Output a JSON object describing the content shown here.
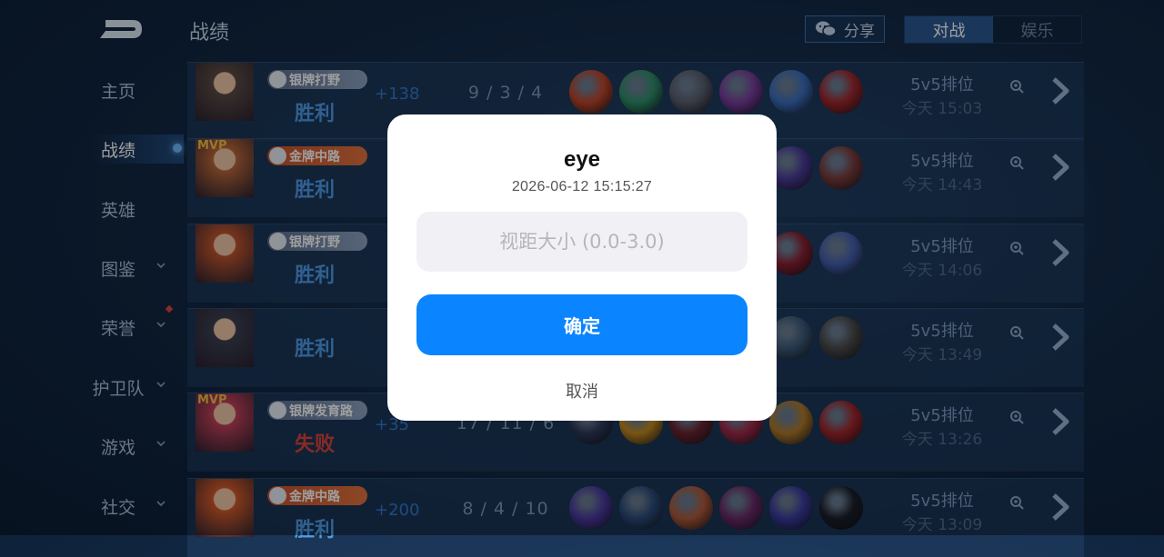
{
  "header": {
    "title": "战绩",
    "share_label": "分享",
    "segments": [
      {
        "label": "对战",
        "active": true
      },
      {
        "label": "娱乐",
        "active": false
      }
    ]
  },
  "sidebar": {
    "items": [
      {
        "label": "主页",
        "has_chevron": false
      },
      {
        "label": "战绩",
        "has_chevron": false,
        "active": true
      },
      {
        "label": "英雄",
        "has_chevron": false
      },
      {
        "label": "图鉴",
        "has_chevron": true
      },
      {
        "label": "荣誉",
        "has_chevron": true,
        "has_red_dot": true
      },
      {
        "label": "护卫队",
        "has_chevron": true
      },
      {
        "label": "游戏",
        "has_chevron": true
      },
      {
        "label": "社交",
        "has_chevron": true
      }
    ]
  },
  "matches": [
    {
      "badge": "银牌打野",
      "badge_tier": "silver",
      "mvp": false,
      "result": "胜利",
      "outcome": "win",
      "score": "+138",
      "kda": "9 / 3 / 4",
      "mode": "5v5排位",
      "time": "今天 15:03",
      "avatar_color": "#5b4a44",
      "item_colors": [
        "#c0452a",
        "#2f8f6a",
        "#5a5f6e",
        "#7a3d9e",
        "#3a6fc0",
        "#a3262c"
      ]
    },
    {
      "badge": "金牌中路",
      "badge_tier": "gold",
      "mvp": true,
      "result": "胜利",
      "outcome": "win",
      "score": "",
      "kda": "",
      "mode": "5v5排位",
      "time": "今天 14:43",
      "avatar_color": "#b8663a",
      "item_colors": [
        "#4b3a9a",
        "#7a3b3b"
      ]
    },
    {
      "badge": "银牌打野",
      "badge_tier": "silver",
      "mvp": false,
      "result": "胜利",
      "outcome": "win",
      "score": "",
      "kda": "",
      "mode": "5v5排位",
      "time": "今天 14:06",
      "avatar_color": "#c0552e",
      "item_colors": [
        "#8a2030",
        "#4460b0"
      ]
    },
    {
      "badge": "",
      "badge_tier": "",
      "mvp": false,
      "result": "胜利",
      "outcome": "win",
      "score": "",
      "kda": "",
      "mode": "5v5排位",
      "time": "今天 13:49",
      "avatar_color": "#3b3f52",
      "item_colors": [
        "#3b5a7a",
        "#4a4a4a"
      ]
    },
    {
      "badge": "银牌发育路",
      "badge_tier": "silver",
      "mvp": true,
      "result": "失败",
      "outcome": "lose",
      "score": "+35",
      "kda": "17 / 11 / 6",
      "mode": "5v5排位",
      "time": "今天 13:26",
      "avatar_color": "#c2405a",
      "item_colors": [
        "#2d3a5a",
        "#c28a20",
        "#6a2430",
        "#a02a4a",
        "#b07a2a",
        "#a3262c"
      ]
    },
    {
      "badge": "金牌中路",
      "badge_tier": "gold",
      "mvp": false,
      "result": "胜利",
      "outcome": "win",
      "score": "+200",
      "kda": "8 / 4 / 10",
      "mode": "5v5排位",
      "time": "今天 13:09",
      "avatar_color": "#d35a2a",
      "item_colors": [
        "#4a3aa0",
        "#2a4a7a",
        "#b05a3a",
        "#6a2a6a",
        "#3a3aa0",
        "#1a1f2a"
      ]
    }
  ],
  "dialog": {
    "title": "eye",
    "subtitle": "2026-06-12 15:15:27",
    "input_placeholder": "视距大小 (0.0-3.0)",
    "input_value": "",
    "confirm_label": "确定",
    "cancel_label": "取消"
  }
}
